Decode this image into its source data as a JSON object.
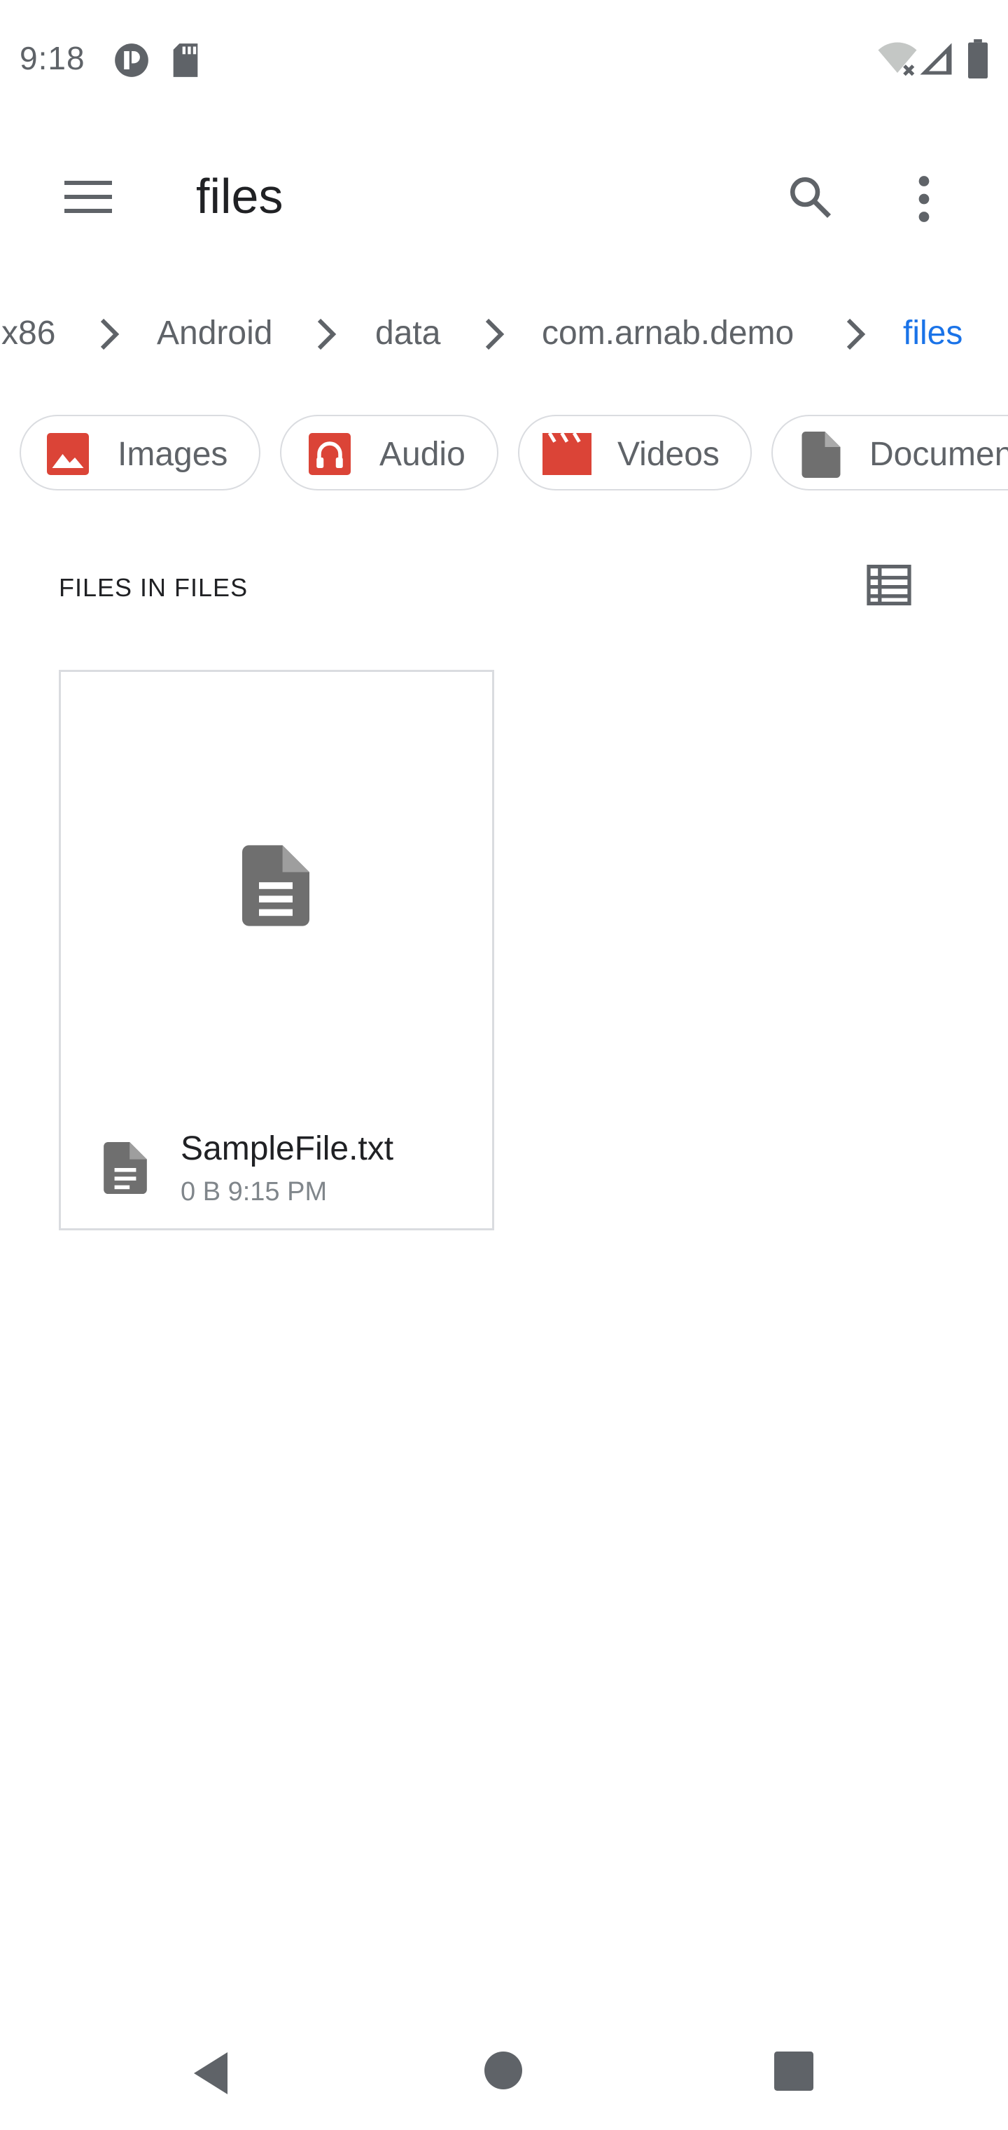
{
  "status_bar": {
    "time": "9:18"
  },
  "app_bar": {
    "title": "files"
  },
  "breadcrumb": [
    {
      "label": "x86"
    },
    {
      "label": "Android"
    },
    {
      "label": "data"
    },
    {
      "label": "com.arnab.demo"
    },
    {
      "label": "files",
      "active": true
    }
  ],
  "chips": [
    {
      "label": "Images",
      "icon": "image-icon"
    },
    {
      "label": "Audio",
      "icon": "audio-icon"
    },
    {
      "label": "Videos",
      "icon": "video-icon"
    },
    {
      "label": "Documents",
      "icon": "document-icon"
    }
  ],
  "section": {
    "title": "FILES IN FILES"
  },
  "files": [
    {
      "name": "SampleFile.txt",
      "meta": "0 B 9:15 PM"
    }
  ],
  "colors": {
    "accent": "#1a73e8",
    "chip_icon": "#db4437",
    "icon_gray": "#5f6368"
  }
}
